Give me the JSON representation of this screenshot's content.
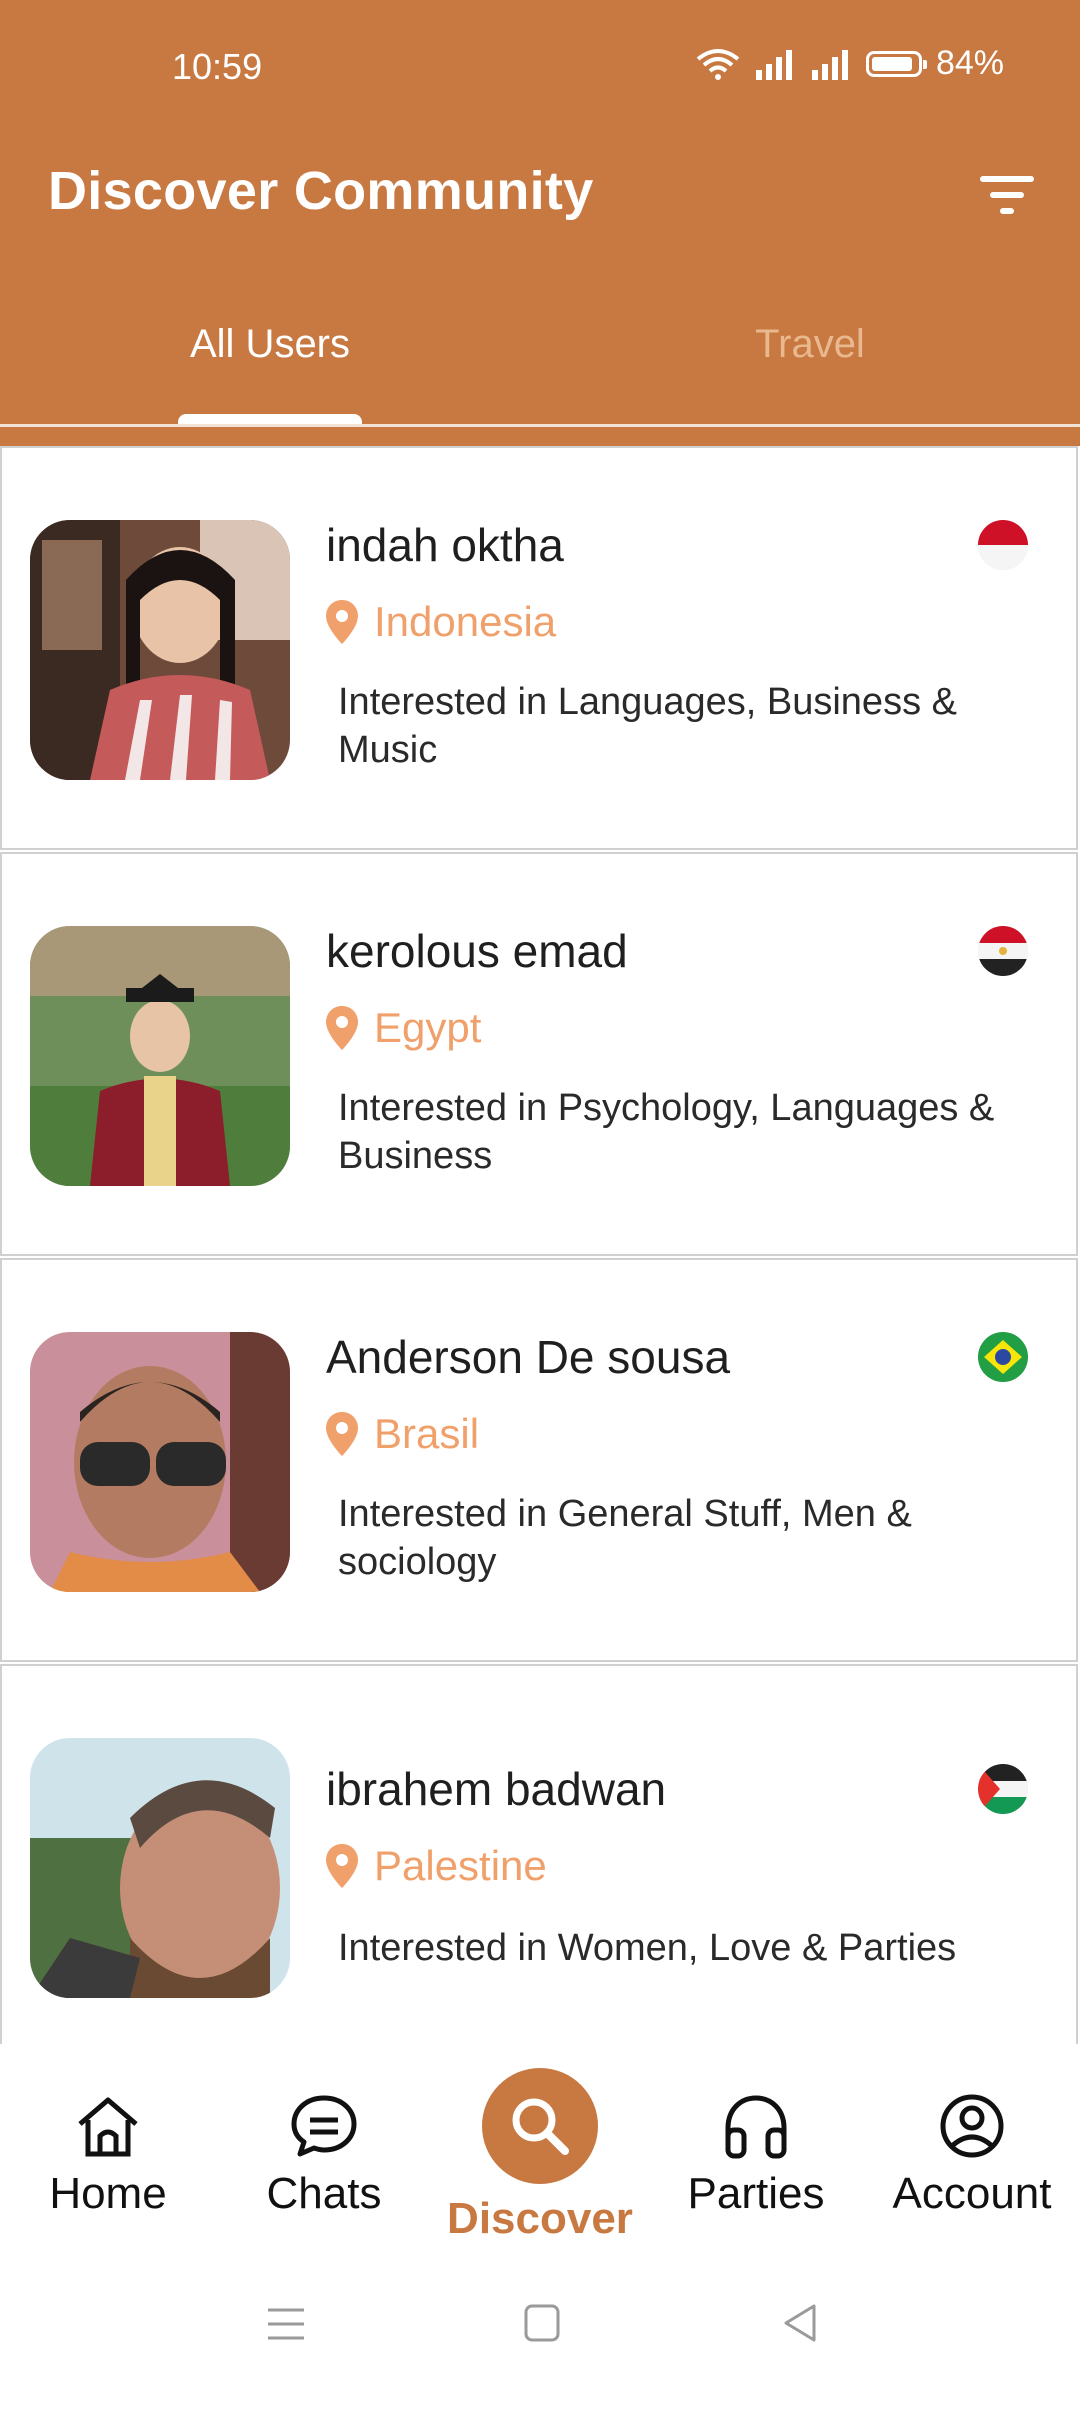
{
  "status_bar": {
    "time": "10:59",
    "battery": "84%"
  },
  "header": {
    "title": "Discover Community"
  },
  "tabs": [
    {
      "label": "All Users"
    },
    {
      "label": "Travel"
    }
  ],
  "users": [
    {
      "name": "indah oktha",
      "location": "Indonesia",
      "interests": "Interested in Languages, Business & Music",
      "flag": "indonesia-flag"
    },
    {
      "name": "kerolous emad",
      "location": "Egypt",
      "interests": "Interested in Psychology, Languages & Business",
      "flag": "egypt-flag"
    },
    {
      "name": "Anderson De sousa",
      "location": "Brasil",
      "interests": "Interested in General Stuff,   Men  & sociology",
      "flag": "brazil-flag"
    },
    {
      "name": "ibrahem badwan",
      "location": "Palestine",
      "interests": "Interested in Women, Love & Parties",
      "flag": "palestine-flag"
    }
  ],
  "bottom_nav": [
    {
      "label": "Home",
      "icon": "home-icon"
    },
    {
      "label": "Chats",
      "icon": "chat-icon"
    },
    {
      "label": "Discover",
      "icon": "search-icon"
    },
    {
      "label": "Parties",
      "icon": "headphones-icon"
    },
    {
      "label": "Account",
      "icon": "account-icon"
    }
  ],
  "colors": {
    "primary": "#c87941",
    "location": "#f0a06a",
    "tab_inactive": "#e9b88f"
  }
}
